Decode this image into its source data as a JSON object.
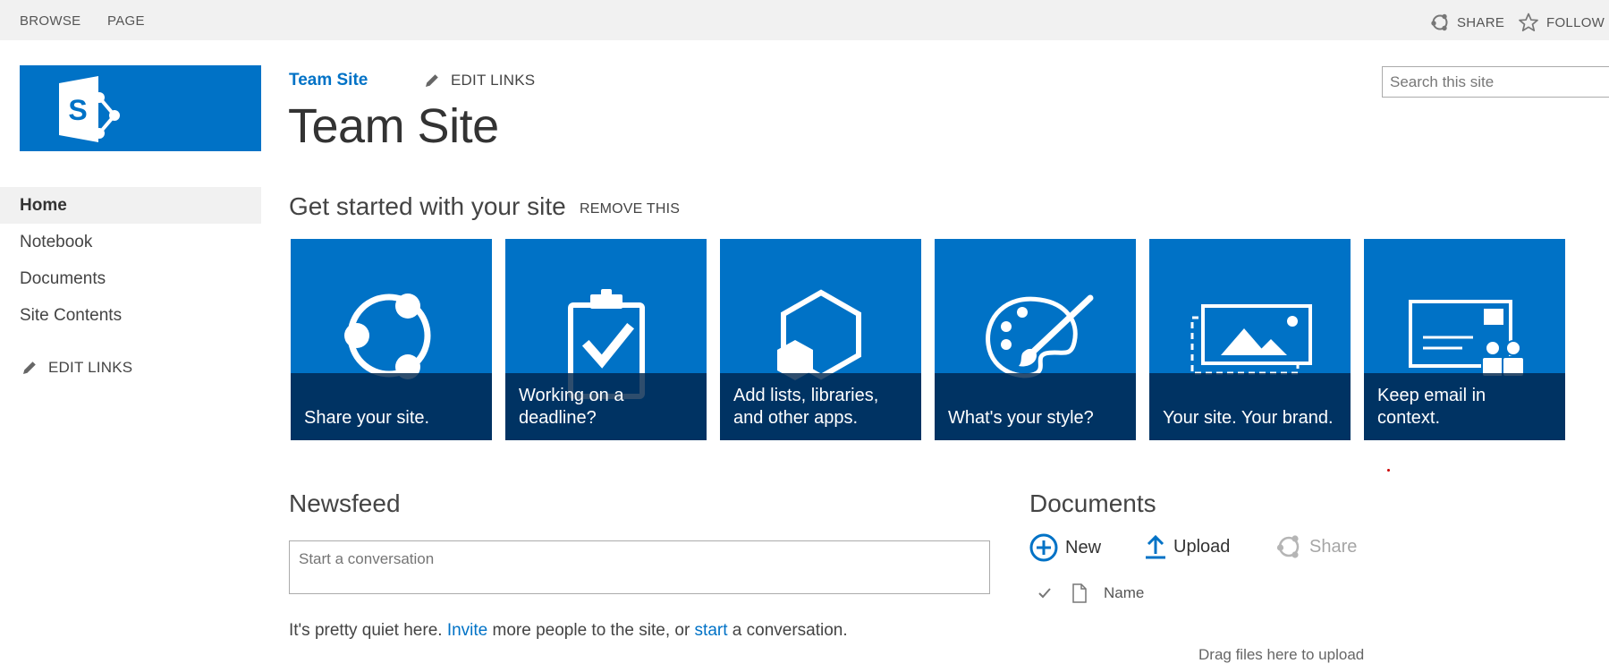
{
  "suitebar": {
    "tabs": [
      "BROWSE",
      "PAGE"
    ],
    "share_label": "SHARE",
    "follow_label": "FOLLOW"
  },
  "header": {
    "site_link": "Team Site",
    "edit_links": "EDIT LINKS",
    "title": "Team Site",
    "search_placeholder": "Search this site"
  },
  "nav": {
    "items": [
      "Home",
      "Notebook",
      "Documents",
      "Site Contents"
    ],
    "selected": "Home",
    "edit_links": "EDIT LINKS"
  },
  "get_started": {
    "heading": "Get started with your site",
    "remove": "REMOVE THIS",
    "tiles": [
      {
        "label": "Share your site.",
        "icon": "share-icon"
      },
      {
        "label": "Working on a deadline?",
        "icon": "clipboard-check-icon"
      },
      {
        "label": "Add lists, libraries, and other apps.",
        "icon": "hexagon-apps-icon"
      },
      {
        "label": "What's your style?",
        "icon": "palette-icon"
      },
      {
        "label": "Your site. Your brand.",
        "icon": "image-brand-icon"
      },
      {
        "label": "Keep email in context.",
        "icon": "email-people-icon"
      }
    ]
  },
  "newsfeed": {
    "heading": "Newsfeed",
    "placeholder": "Start a conversation",
    "quiet_1": "It's pretty quiet here. ",
    "invite_link": "Invite",
    "quiet_2": " more people to the site, or ",
    "start_link": "start",
    "quiet_3": " a conversation."
  },
  "documents": {
    "heading": "Documents",
    "new_label": "New",
    "upload_label": "Upload",
    "share_label": "Share",
    "column_name": "Name",
    "drag_text": "Drag files here to upload"
  },
  "colors": {
    "accent": "#0072c6",
    "tile_overlay": "#00264d",
    "suitebar": "#f1f1f1",
    "disabled": "#a6a6a6"
  }
}
